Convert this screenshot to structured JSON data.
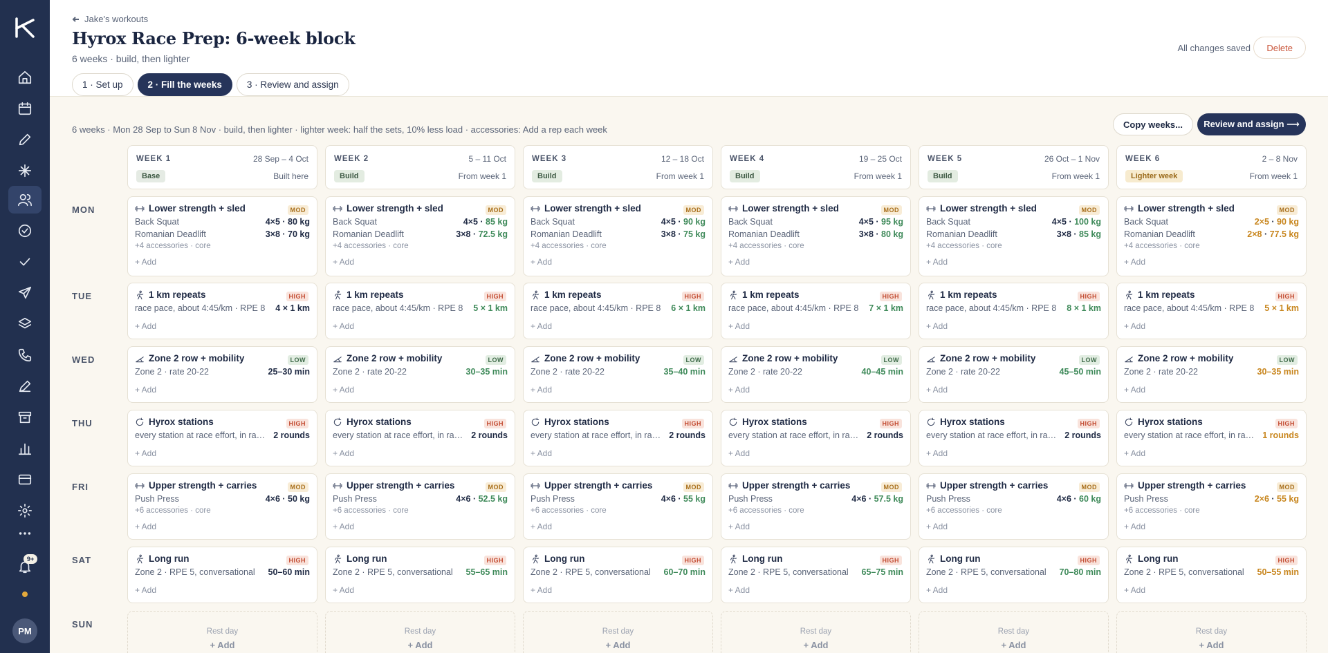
{
  "nav": {
    "items": [
      "home-icon",
      "calendar-icon",
      "pencil-icon",
      "sparkle-icon",
      "users-icon",
      "check-circle-icon",
      "check-icon",
      "send-icon",
      "layers-icon",
      "phone-icon",
      "pen-icon",
      "archive-icon",
      "bar-chart-icon",
      "card-icon",
      "gear-icon",
      "more-icon",
      "bell-icon"
    ],
    "notification_count": "9+",
    "avatar_initials": "PM"
  },
  "header": {
    "breadcrumb": "Jake's workouts",
    "title": "Hyrox Race Prep: 6-week block",
    "subtitle": "6 weeks · build, then lighter",
    "steps": [
      "1 · Set up",
      "2 · Fill the weeks",
      "3 · Review and assign"
    ],
    "active_step": 1,
    "save_status": "All changes saved",
    "delete_label": "Delete"
  },
  "toolbar": {
    "summary": "6 weeks · Mon 28 Sep to Sun 8 Nov · build, then lighter · lighter week: half the sets, 10% less load · accessories: Add a rep each week",
    "copy_label": "Copy weeks...",
    "review_label": "Review and assign ⟶"
  },
  "colors": {
    "primary": "#26345a",
    "sidebar": "#22304f",
    "increase": "#3f8a5a",
    "decrease": "#c8861e",
    "high": "#c24a30",
    "mod": "#a86e1a",
    "low": "#3e6a48"
  },
  "days": [
    "MON",
    "TUE",
    "WED",
    "THU",
    "FRI",
    "SAT",
    "SUN"
  ],
  "weeks": [
    {
      "name": "WEEK 1",
      "dates": "28 Sep – 4 Oct",
      "tag": "Base",
      "tag_type": "base",
      "source": "Built here"
    },
    {
      "name": "WEEK 2",
      "dates": "5 – 11 Oct",
      "tag": "Build",
      "tag_type": "build",
      "source": "From week 1"
    },
    {
      "name": "WEEK 3",
      "dates": "12 – 18 Oct",
      "tag": "Build",
      "tag_type": "build",
      "source": "From week 1"
    },
    {
      "name": "WEEK 4",
      "dates": "19 – 25 Oct",
      "tag": "Build",
      "tag_type": "build",
      "source": "From week 1"
    },
    {
      "name": "WEEK 5",
      "dates": "26 Oct – 1 Nov",
      "tag": "Build",
      "tag_type": "build",
      "source": "From week 1"
    },
    {
      "name": "WEEK 6",
      "dates": "2 – 8 Nov",
      "tag": "Lighter week",
      "tag_type": "lighter",
      "source": "From week 1"
    }
  ],
  "common": {
    "add_label": "+ Add",
    "rest_label": "Rest day",
    "intensity_labels": {
      "mod": "MOD",
      "high": "HIGH",
      "low": "LOW"
    }
  },
  "sessions": {
    "mon": {
      "title": "Lower strength + sled",
      "icon": "dumbbell-icon",
      "intensity": "mod",
      "lines": [
        "Back Squat",
        "Romanian Deadlift"
      ],
      "accessories": "+4 accessories · core",
      "values": [
        [
          "4×5 · 80 kg",
          "3×8 · 70 kg"
        ],
        [
          "4×5 · 85 kg",
          "3×8 · 72.5 kg"
        ],
        [
          "4×5 · 90 kg",
          "3×8 · 75 kg"
        ],
        [
          "4×5 · 95 kg",
          "3×8 · 80 kg"
        ],
        [
          "4×5 · 100 kg",
          "3×8 · 85 kg"
        ],
        [
          "2×5 · 90 kg",
          "2×8 · 77.5 kg"
        ]
      ]
    },
    "tue": {
      "title": "1 km repeats",
      "icon": "runner-icon",
      "intensity": "high",
      "lines": [
        "race pace, about 4:45/km · RPE 8"
      ],
      "values": [
        [
          "4 × 1 km"
        ],
        [
          "5 × 1 km"
        ],
        [
          "6 × 1 km"
        ],
        [
          "7 × 1 km"
        ],
        [
          "8 × 1 km"
        ],
        [
          "5 × 1 km"
        ]
      ]
    },
    "wed": {
      "title": "Zone 2 row + mobility",
      "icon": "row-icon",
      "intensity": "low",
      "lines": [
        "Zone 2 · rate 20-22"
      ],
      "values": [
        [
          "25–30 min"
        ],
        [
          "30–35 min"
        ],
        [
          "35–40 min"
        ],
        [
          "40–45 min"
        ],
        [
          "45–50 min"
        ],
        [
          "30–35 min"
        ]
      ]
    },
    "thu": {
      "title": "Hyrox stations",
      "icon": "cycle-icon",
      "intensity": "high",
      "lines": [
        "every station at race effort, in race order"
      ],
      "values": [
        [
          "2 rounds"
        ],
        [
          "2 rounds"
        ],
        [
          "2 rounds"
        ],
        [
          "2 rounds"
        ],
        [
          "2 rounds"
        ],
        [
          "1 rounds"
        ]
      ]
    },
    "fri": {
      "title": "Upper strength + carries",
      "icon": "dumbbell-icon",
      "intensity": "mod",
      "lines": [
        "Push Press"
      ],
      "accessories": "+6 accessories · core",
      "values": [
        [
          "4×6 · 50 kg"
        ],
        [
          "4×6 · 52.5 kg"
        ],
        [
          "4×6 · 55 kg"
        ],
        [
          "4×6 · 57.5 kg"
        ],
        [
          "4×6 · 60 kg"
        ],
        [
          "2×6 · 55 kg"
        ]
      ]
    },
    "sat": {
      "title": "Long run",
      "icon": "runner-icon",
      "intensity": "high",
      "lines": [
        "Zone 2 · RPE 5, conversational"
      ],
      "values": [
        [
          "50–60 min"
        ],
        [
          "55–65 min"
        ],
        [
          "60–70 min"
        ],
        [
          "65–75 min"
        ],
        [
          "70–80 min"
        ],
        [
          "50–55 min"
        ]
      ]
    }
  }
}
